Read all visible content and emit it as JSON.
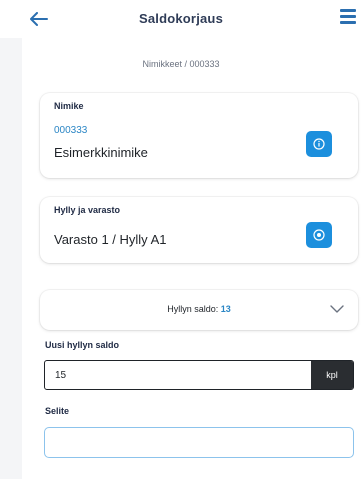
{
  "header": {
    "title": "Saldokorjaus",
    "back_icon": "arrow-left-icon",
    "menu_icon": "hamburger-menu-icon"
  },
  "breadcrumb": "Nimikkeet / 000333",
  "item_card": {
    "label": "Nimike",
    "code": "000333",
    "name": "Esimerkkinimike",
    "info_icon": "info-icon"
  },
  "shelf_card": {
    "label": "Hylly ja varasto",
    "value": "Varasto 1 / Hylly A1",
    "action_icon": "target-icon"
  },
  "shelf_balance": {
    "label": "Hyllyn saldo:",
    "value": "13",
    "expand_icon": "chevron-down-icon"
  },
  "new_balance": {
    "label": "Uusi hyllyn saldo",
    "value": "15",
    "unit": "kpl"
  },
  "description": {
    "label": "Selite",
    "value": ""
  },
  "colors": {
    "accent": "#1c8fdd",
    "link": "#2b86c5",
    "title": "#2f3c57",
    "unit_bg": "#2a2d31",
    "focus_border": "#8cc3ec"
  }
}
